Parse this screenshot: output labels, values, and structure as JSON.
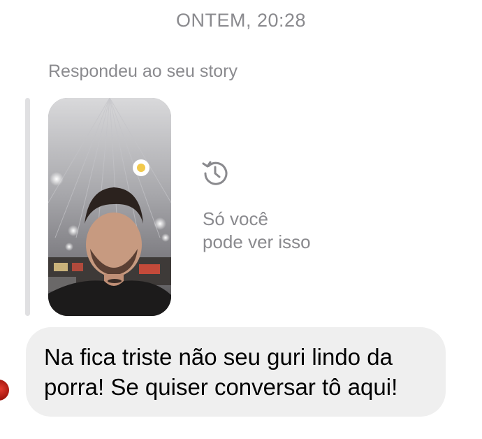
{
  "conversation": {
    "timestamp": "ONTEM, 20:28",
    "reply_context": "Respondeu ao seu story",
    "story_privacy_note": {
      "line1": "Só você",
      "line2": "pode ver isso"
    },
    "message": {
      "line1": "Na fica triste não seu guri lindo da",
      "line2": "porra! Se quiser conversar tô aqui!"
    }
  },
  "icons": {
    "history": "history-clock-icon",
    "story_sticker": "emoji-sticker-icon",
    "avatar": "sender-avatar"
  },
  "colors": {
    "meta_text": "#8a8a8e",
    "bubble_background": "#efefef",
    "reply_bar": "#e0e0e2",
    "message_text": "#000000"
  }
}
